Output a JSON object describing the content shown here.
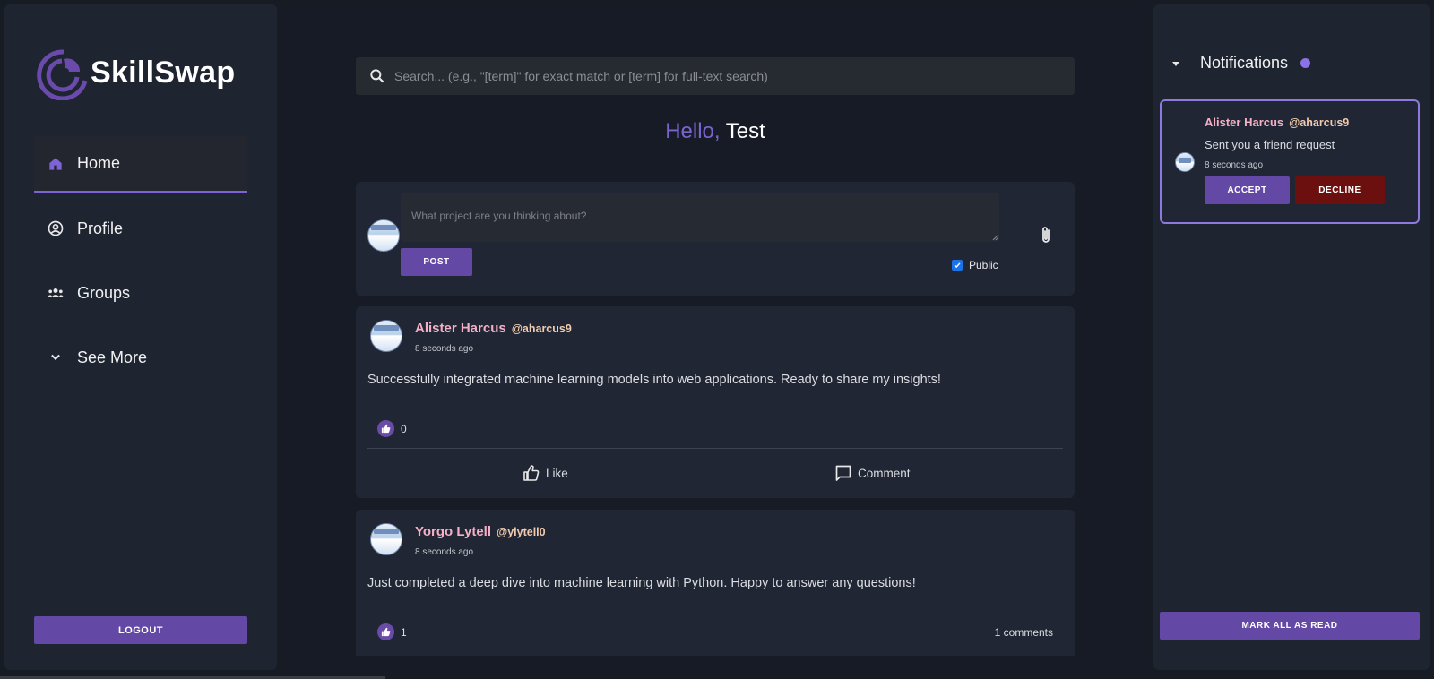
{
  "brand": {
    "name": "SkillSwap",
    "accent": "#7d63d6",
    "button_color": "#6348a5",
    "decline_color": "#6b0f0f"
  },
  "nav": {
    "items": [
      {
        "label": "Home",
        "icon": "home-icon",
        "active": true
      },
      {
        "label": "Profile",
        "icon": "account-circle-icon",
        "active": false
      },
      {
        "label": "Groups",
        "icon": "groups-icon",
        "active": false
      },
      {
        "label": "See More",
        "icon": "chevron-down-icon",
        "active": false
      }
    ],
    "logout_label": "LOGOUT"
  },
  "search": {
    "placeholder": "Search... (e.g., \"[term]\" for exact match or [term] for full-text search)"
  },
  "greeting": {
    "hello": "Hello,",
    "name": "Test"
  },
  "composer": {
    "placeholder": "What project are you thinking about?",
    "post_label": "POST",
    "public_label": "Public",
    "public_checked": true
  },
  "posts": [
    {
      "author": "Alister Harcus",
      "handle": "@aharcus9",
      "time": "8 seconds ago",
      "body": "Successfully integrated machine learning models into web applications. Ready to share my insights!",
      "likes": "0",
      "like_label": "Like",
      "comment_label": "Comment"
    },
    {
      "author": "Yorgo Lytell",
      "handle": "@ylytell0",
      "time": "8 seconds ago",
      "body": "Just completed a deep dive into machine learning with Python. Happy to answer any questions!",
      "likes": "1",
      "comments": "1 comments"
    }
  ],
  "notifications": {
    "title": "Notifications",
    "items": [
      {
        "author": "Alister Harcus",
        "handle": "@aharcus9",
        "message": "Sent you a friend request",
        "time": "8 seconds ago",
        "accept_label": "ACCEPT",
        "decline_label": "DECLINE"
      }
    ],
    "mark_all_label": "MARK ALL AS READ"
  }
}
